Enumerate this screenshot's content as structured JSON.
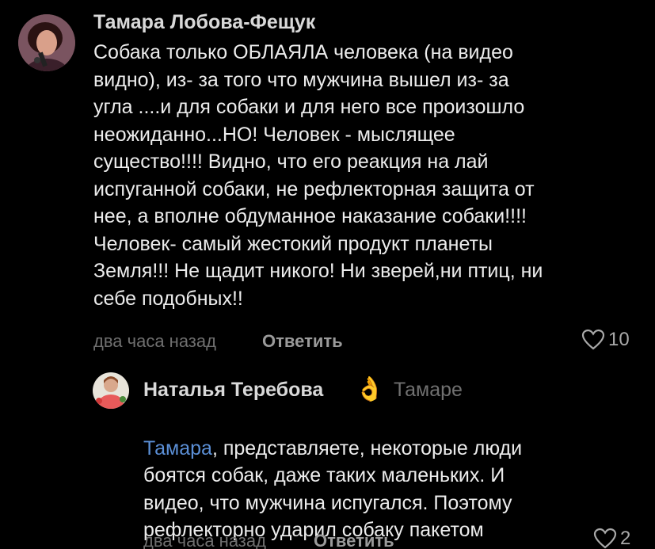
{
  "comment": {
    "author": "Тамара Лобова-Фещук",
    "text": "Собака только ОБЛАЯЛА  человека (на видео\nвидно), из- за того что мужчина вышел из- за\nугла ....и для собаки и для него все произошло\nнеожиданно...НО! Человек - мыслящее\nсущество!!!! Видно, что его реакция на лай\nиспуганной собаки, не рефлекторная защита от\nнее, а вполне обдуманное наказание собаки!!!!\nЧеловек- самый жестокий продукт  планеты\nЗемля!!! Не щадит никого! Ни зверей,ни птиц, ни\nсебе подобных!!",
    "time": "два часа назад",
    "reply_label": "Ответить",
    "likes": "10"
  },
  "reply": {
    "author": "Наталья Теребова",
    "emoji": "👌",
    "to": "Тамаре",
    "mention": "Тамара",
    "text_first": ", представляете, некоторые люди",
    "text_rest": "боятся собак, даже таких маленьких. И\nвидео, что мужчина испугался. Поэтому\nрефлекторно ударил собаку пакетом",
    "time": "два часа назад",
    "reply_label": "Ответить",
    "likes": "2"
  },
  "colors": {
    "background": "#000000",
    "text": "#ececec",
    "muted": "#6f6f6f",
    "mention": "#5b8fd6"
  }
}
